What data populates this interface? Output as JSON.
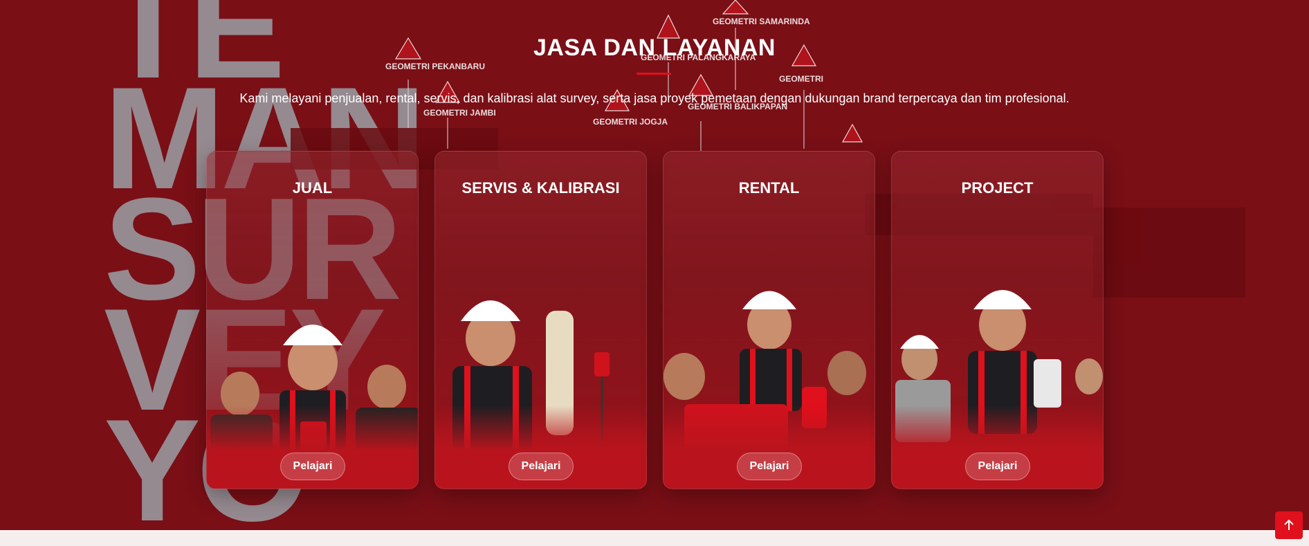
{
  "section": {
    "title": "JASA DAN LAYANAN",
    "subtitle": "Kami melayani penjualan, rental, servis, dan kalibrasi alat survey, serta jasa proyek pemetaan dengan dukungan brand terpercaya dan tim profesional."
  },
  "background": {
    "letters": [
      "TE",
      "MAN",
      "SUR",
      "VEY",
      "YO"
    ],
    "pins": [
      "GEOMETRI PEKANBARU",
      "GEOMETRI JAMBI",
      "GEOMETRI PALANGKARAYA",
      "GEOMETRI SAMARINDA",
      "GEOMETRI JOGJA",
      "GEOMETRI BALIKPAPAN",
      "GEOMETRI"
    ]
  },
  "cards": [
    {
      "title": "JUAL",
      "button": "Pelajari"
    },
    {
      "title": "SERVIS & KALIBRASI",
      "button": "Pelajari"
    },
    {
      "title": "RENTAL",
      "button": "Pelajari"
    },
    {
      "title": "PROJECT",
      "button": "Pelajari"
    }
  ],
  "colors": {
    "background": "#7a0f16",
    "accent": "#e0101c",
    "card_bottom": "#b9141d",
    "footer_strip": "#f4efee"
  },
  "icons": {
    "scroll_top": "arrow-up-icon"
  }
}
